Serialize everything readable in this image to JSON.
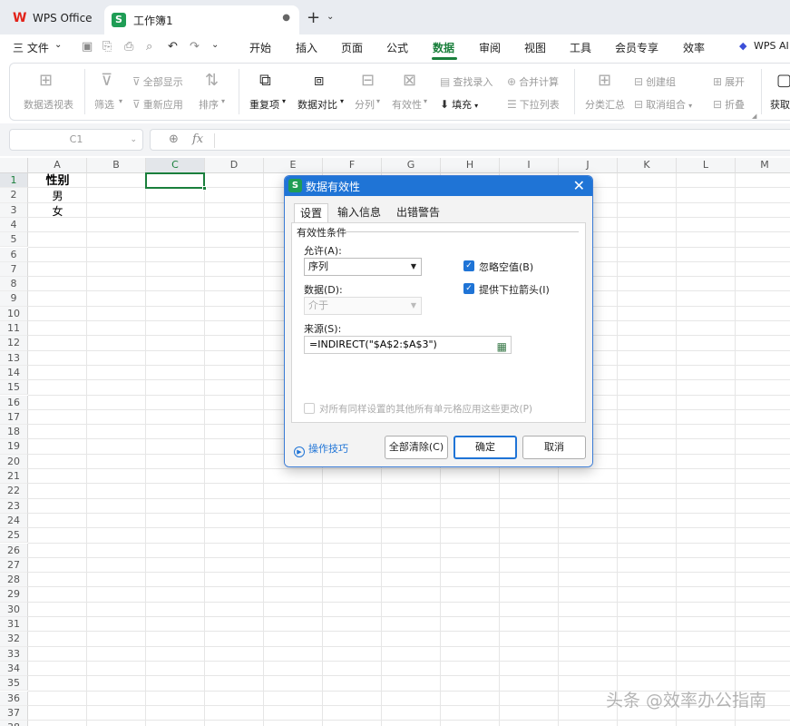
{
  "tabs": {
    "app": "WPS Office",
    "doc": "工作簿1"
  },
  "menu": {
    "file": "三 文件",
    "items": [
      "开始",
      "插入",
      "页面",
      "公式",
      "数据",
      "审阅",
      "视图",
      "工具",
      "会员专享",
      "效率"
    ],
    "active_index": 4,
    "ai": "WPS AI"
  },
  "ribbon": {
    "pivot": "数据透视表",
    "filter": "筛选",
    "show_all": "全部显示",
    "reapply": "重新应用",
    "sort": "排序",
    "duplicates": "重复项",
    "compare": "数据对比",
    "split": "分列",
    "validity": "有效性",
    "find_entry": "查找录入",
    "fill": "填充",
    "consolidate": "合并计算",
    "dropdown_list": "下拉列表",
    "subtotal": "分类汇总",
    "create_group": "创建组",
    "ungroup": "取消组合",
    "expand": "展开",
    "collapse": "折叠",
    "get": "获取"
  },
  "formula_bar": {
    "cell_ref": "C1",
    "fx": "fx",
    "value": ""
  },
  "grid": {
    "columns": [
      "A",
      "B",
      "C",
      "D",
      "E",
      "F",
      "G",
      "H",
      "I",
      "J",
      "K",
      "L",
      "M"
    ],
    "selected_column": "C",
    "rows": [
      "1",
      "2",
      "3",
      "4",
      "5",
      "6",
      "7",
      "8",
      "9",
      "10",
      "11",
      "12",
      "13",
      "14",
      "15",
      "16",
      "17",
      "18",
      "19",
      "20",
      "21",
      "22",
      "23",
      "24",
      "25",
      "26",
      "27",
      "28",
      "29",
      "30",
      "31",
      "32",
      "33",
      "34",
      "35",
      "36",
      "37",
      "38"
    ],
    "cells": {
      "A1": "性别",
      "A2": "男",
      "A3": "女"
    }
  },
  "dialog": {
    "title": "数据有效性",
    "tabs": [
      "设置",
      "输入信息",
      "出错警告"
    ],
    "group_label": "有效性条件",
    "allow_label": "允许(A):",
    "allow_value": "序列",
    "data_label": "数据(D):",
    "data_value": "介于",
    "ignore_blank": "忽略空值(B)",
    "dropdown_arrow": "提供下拉箭头(I)",
    "source_label": "来源(S):",
    "source_value": "=INDIRECT(\"$A$2:$A$3\")",
    "apply_all": "对所有同样设置的其他所有单元格应用这些更改(P)",
    "tips": "操作技巧",
    "clear_all": "全部清除(C)",
    "ok": "确定",
    "cancel": "取消"
  },
  "watermark": "头条 @效率办公指南",
  "colors": {
    "accent_green": "#1a7f3c",
    "dialog_blue": "#1f74d6",
    "wps_red": "#e2231a"
  }
}
